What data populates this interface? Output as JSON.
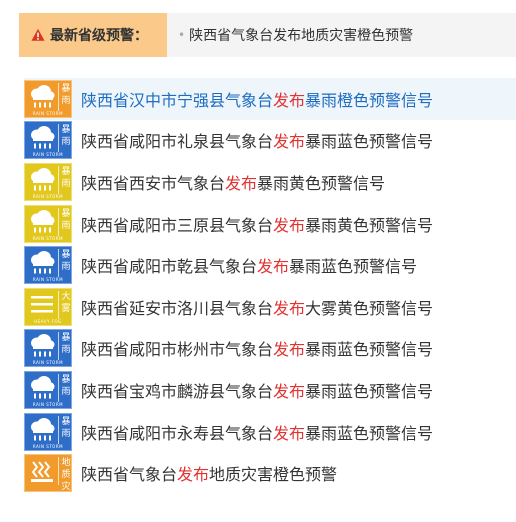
{
  "provincial_alert": {
    "label": "最新省级预警：",
    "bullet": "•",
    "content": "陕西省气象台发布地质灾害橙色预警"
  },
  "warnings": [
    {
      "prefix": "陕西省汉中市宁强县气象台",
      "verb": "发布",
      "suffix": "暴雨橙色预警信号",
      "type": "rainstorm",
      "type_cn": "暴雨",
      "type_en": "RAIN STORM",
      "color": "orange",
      "color_hex": "#f19b2c",
      "icon": "rainstorm-icon"
    },
    {
      "prefix": "陕西省咸阳市礼泉县气象台",
      "verb": "发布",
      "suffix": "暴雨蓝色预警信号",
      "type": "rainstorm",
      "type_cn": "暴雨",
      "type_en": "RAIN STORM",
      "color": "blue",
      "color_hex": "#2e6ec8",
      "icon": "rainstorm-icon"
    },
    {
      "prefix": "陕西省西安市气象台",
      "verb": "发布",
      "suffix": "暴雨黄色预警信号",
      "type": "rainstorm",
      "type_cn": "暴雨",
      "type_en": "RAIN STORM",
      "color": "yellow",
      "color_hex": "#e2c81c",
      "icon": "rainstorm-icon"
    },
    {
      "prefix": "陕西省咸阳市三原县气象台",
      "verb": "发布",
      "suffix": "暴雨黄色预警信号",
      "type": "rainstorm",
      "type_cn": "暴雨",
      "type_en": "RAIN STORM",
      "color": "yellow",
      "color_hex": "#e2c81c",
      "icon": "rainstorm-icon"
    },
    {
      "prefix": "陕西省咸阳市乾县气象台",
      "verb": "发布",
      "suffix": "暴雨蓝色预警信号",
      "type": "rainstorm",
      "type_cn": "暴雨",
      "type_en": "RAIN STORM",
      "color": "blue",
      "color_hex": "#2e6ec8",
      "icon": "rainstorm-icon"
    },
    {
      "prefix": "陕西省延安市洛川县气象台",
      "verb": "发布",
      "suffix": "大雾黄色预警信号",
      "type": "fog",
      "type_cn": "大雾",
      "type_en": "HEAVY FOG",
      "color": "yellow",
      "color_hex": "#e2c81c",
      "icon": "fog-icon"
    },
    {
      "prefix": "陕西省咸阳市彬州市气象台",
      "verb": "发布",
      "suffix": "暴雨蓝色预警信号",
      "type": "rainstorm",
      "type_cn": "暴雨",
      "type_en": "RAIN STORM",
      "color": "blue",
      "color_hex": "#2e6ec8",
      "icon": "rainstorm-icon"
    },
    {
      "prefix": "陕西省宝鸡市麟游县气象台",
      "verb": "发布",
      "suffix": "暴雨蓝色预警信号",
      "type": "rainstorm",
      "type_cn": "暴雨",
      "type_en": "RAIN STORM",
      "color": "blue",
      "color_hex": "#2e6ec8",
      "icon": "rainstorm-icon"
    },
    {
      "prefix": "陕西省咸阳市永寿县气象台",
      "verb": "发布",
      "suffix": "暴雨蓝色预警信号",
      "type": "rainstorm",
      "type_cn": "暴雨",
      "type_en": "RAIN STORM",
      "color": "blue",
      "color_hex": "#2e6ec8",
      "icon": "rainstorm-icon"
    },
    {
      "prefix": "陕西省气象台",
      "verb": "发布",
      "suffix": "地质灾害橙色预警",
      "type": "geohazard",
      "type_cn": "地质灾害",
      "type_en": "",
      "color": "orange",
      "color_hex": "#f19b2c",
      "icon": "geohazard-icon"
    }
  ],
  "colors": {
    "issued_verb": "#e23333",
    "first_item_text": "#1f6cc0",
    "label_background": "#fbc98a",
    "warning_triangle": "#d9381e"
  }
}
